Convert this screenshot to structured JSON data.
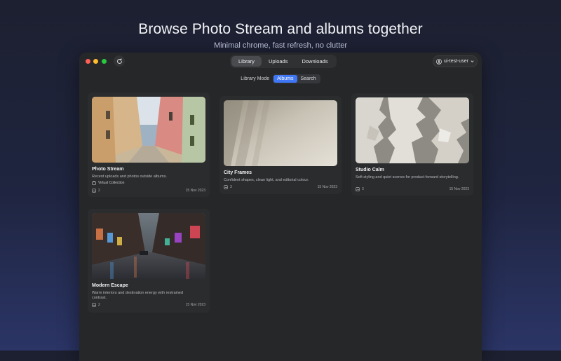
{
  "hero": {
    "title": "Browse Photo Stream and albums together",
    "subtitle": "Minimal chrome, fast refresh, no clutter"
  },
  "window": {
    "nav_tabs": [
      "Library",
      "Uploads",
      "Downloads"
    ],
    "active_tab": "Library",
    "user": "ui-test-user"
  },
  "mode": {
    "label": "Library Mode",
    "options": [
      "Albums",
      "Search"
    ],
    "selected": "Albums"
  },
  "albums": [
    {
      "title": "Photo Stream",
      "description": "Recent uploads and photos outside albums.",
      "collection": "Virtual Collection",
      "count": "2",
      "date": "15 Nov 2023",
      "image_icon": "alley-photo"
    },
    {
      "title": "City Frames",
      "description": "Confident shapes, clean light, and editorial colour.",
      "count": "3",
      "date": "15 Nov 2023",
      "image_icon": "shadow-wall-photo"
    },
    {
      "title": "Studio Calm",
      "description": "Soft styling and quiet scenes for product-forward storytelling.",
      "count": "3",
      "date": "15 Nov 2023",
      "image_icon": "peeling-paint-photo"
    },
    {
      "title": "Modern Escape",
      "description": "Warm interiors and destination energy with restrained contrast.",
      "count": "2",
      "date": "15 Nov 2023",
      "image_icon": "rainy-street-photo"
    }
  ],
  "colors": {
    "accent": "#3f76f5",
    "window_bg": "#262729",
    "card_bg": "#2b2c2e"
  }
}
